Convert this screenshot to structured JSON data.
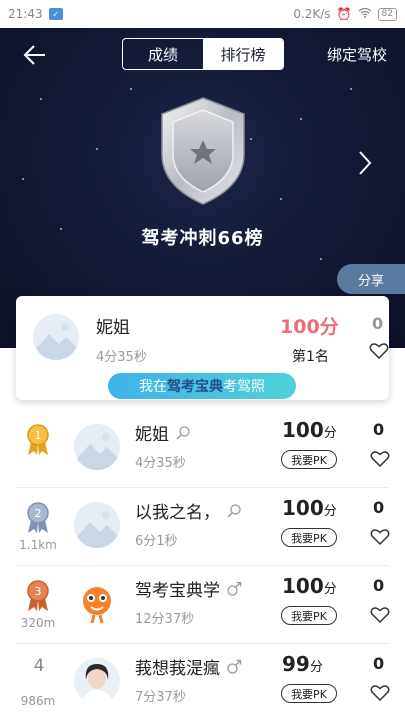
{
  "status_bar": {
    "time": "21:43",
    "network_speed": "0.2K/s",
    "battery": "82"
  },
  "header": {
    "tabs": [
      {
        "label": "成绩",
        "active": false
      },
      {
        "label": "排行榜",
        "active": true
      }
    ],
    "bind_school_label": "绑定驾校",
    "board_title": "驾考冲刺66榜",
    "share_label": "分享"
  },
  "my_card": {
    "name": "妮姐",
    "time": "4分35秒",
    "score": "100分",
    "rank": "第1名",
    "likes": "0",
    "promo_prefix": "我在",
    "promo_brand": "驾考宝典",
    "promo_suffix": "考驾照"
  },
  "list": [
    {
      "rank": "1",
      "distance": "",
      "name": "妮姐",
      "gender_icon": "search-person-icon",
      "time": "4分35秒",
      "score": "100",
      "score_unit": "分",
      "pk_label": "我要PK",
      "likes": "0",
      "medal": "gold"
    },
    {
      "rank": "2",
      "distance": "1.1km",
      "name": "以我之名，",
      "gender_icon": "search-person-icon",
      "time": "6分1秒",
      "score": "100",
      "score_unit": "分",
      "pk_label": "我要PK",
      "likes": "0",
      "medal": "silver"
    },
    {
      "rank": "3",
      "distance": "320m",
      "name": "驾考宝典学",
      "gender_icon": "male-icon",
      "time": "12分37秒",
      "score": "100",
      "score_unit": "分",
      "pk_label": "我要PK",
      "likes": "0",
      "medal": "bronze"
    },
    {
      "rank": "4",
      "distance": "986m",
      "name": "莪想莪湜瘋",
      "gender_icon": "male-icon",
      "time": "7分37秒",
      "score": "99",
      "score_unit": "分",
      "pk_label": "我要PK",
      "likes": "0",
      "medal": ""
    }
  ],
  "colors": {
    "hero_bg": "#121833",
    "score_red": "#f06b7a",
    "promo_blue": "#3fb4e8",
    "share_bg": "#5a7aa0"
  }
}
